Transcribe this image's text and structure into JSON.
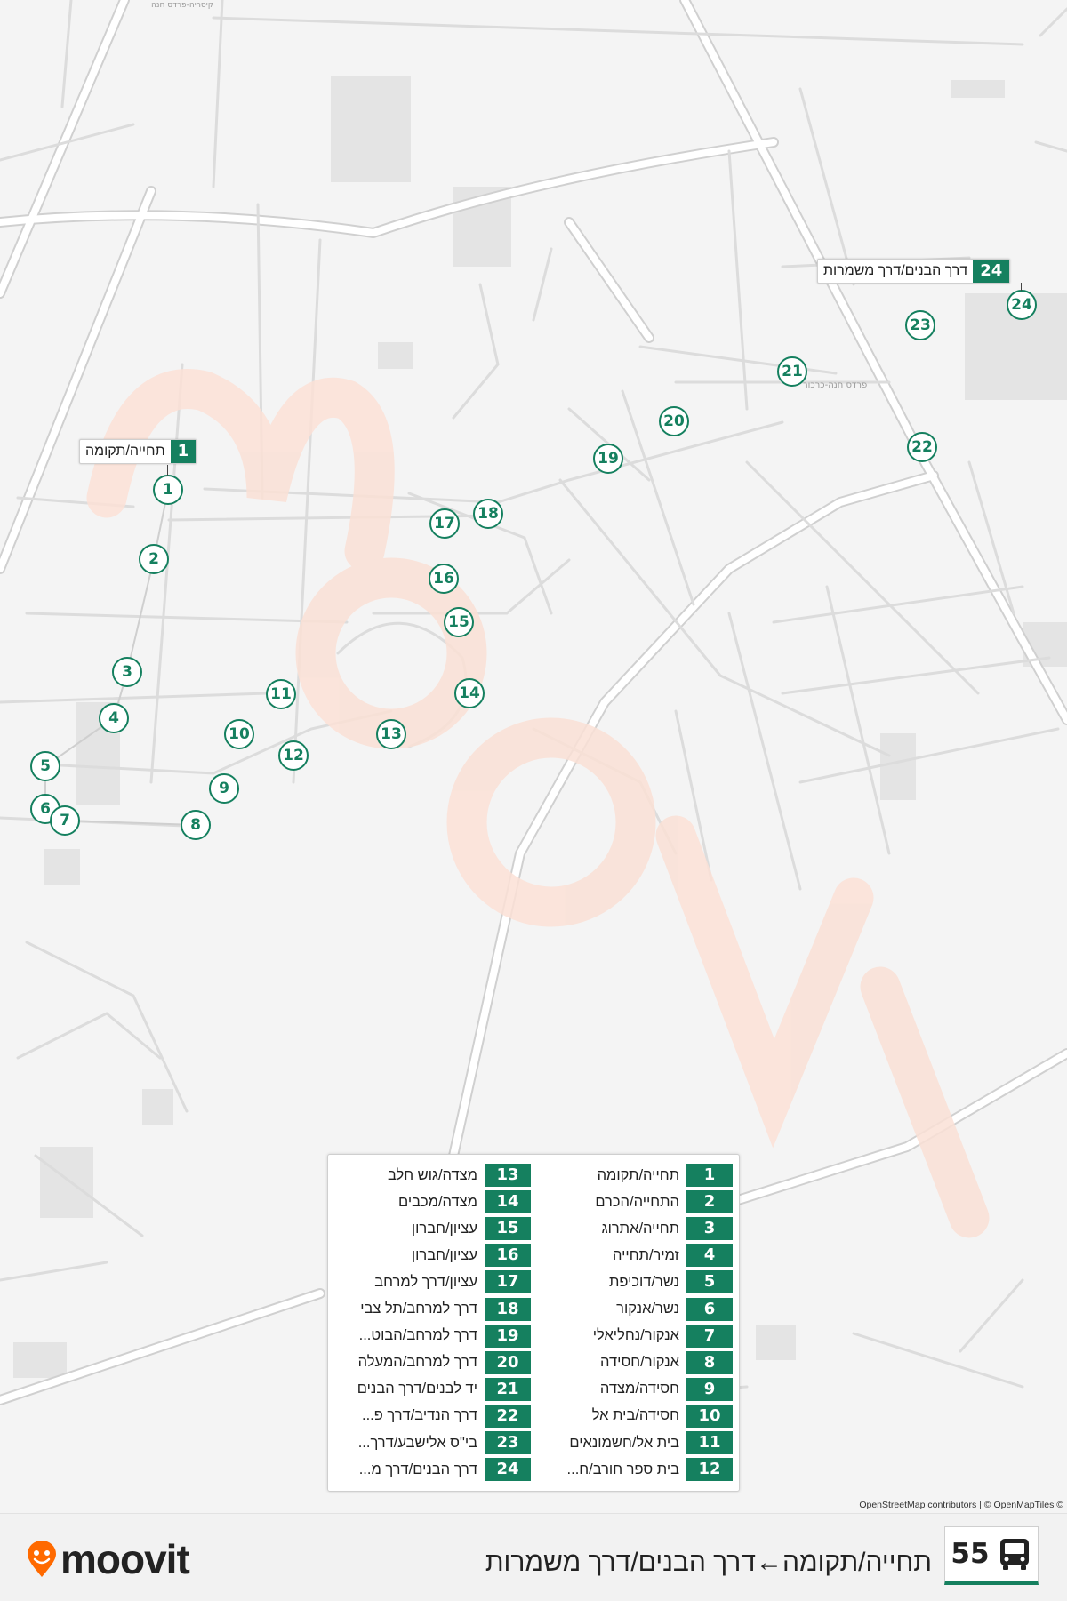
{
  "route": {
    "number": "55",
    "title": "תחייה/תקומה←דרך הבנים/דרך משמרות",
    "bus_icon": "bus-icon",
    "accent_color": "#15805f"
  },
  "brand": {
    "name": "moovit",
    "logo_icon": "moovit-pin-icon",
    "logo_color": "#ff6a00"
  },
  "map": {
    "attribution": "OpenStreetMap contributors | © OpenMapTiles ©",
    "origin_callout": {
      "number": "1",
      "name": "תחייה/תקומה"
    },
    "destination_callout": {
      "number": "24",
      "name": "דרך הבנים/דרך משמרות"
    },
    "street_label_1": "פרדס חנה-כרכור",
    "street_label_2": "קיסריה-פרדס חנה"
  },
  "stops": [
    {
      "number": "1",
      "name": "תחייה/תקומה"
    },
    {
      "number": "2",
      "name": "התחייה/הכרם"
    },
    {
      "number": "3",
      "name": "תחייה/אתרוג"
    },
    {
      "number": "4",
      "name": "זמיר/תחייה"
    },
    {
      "number": "5",
      "name": "נשר/דוכיפת"
    },
    {
      "number": "6",
      "name": "נשר/אנקור"
    },
    {
      "number": "7",
      "name": "אנקור/נחליאלי"
    },
    {
      "number": "8",
      "name": "אנקור/חסידה"
    },
    {
      "number": "9",
      "name": "חסידה/מצדה"
    },
    {
      "number": "10",
      "name": "חסידה/בית אל"
    },
    {
      "number": "11",
      "name": "בית אל/חשמונאים"
    },
    {
      "number": "12",
      "name": "בית ספר חורב/ח..."
    },
    {
      "number": "13",
      "name": "מצדה/גוש חלב"
    },
    {
      "number": "14",
      "name": "מצדה/מכבים"
    },
    {
      "number": "15",
      "name": "עציון/חברון"
    },
    {
      "number": "16",
      "name": "עציון/חברון"
    },
    {
      "number": "17",
      "name": "עציון/דרך למרחב"
    },
    {
      "number": "18",
      "name": "דרך למרחב/תל צבי"
    },
    {
      "number": "19",
      "name": "דרך למרחב/הבוט..."
    },
    {
      "number": "20",
      "name": "דרך למרחב/המעלה"
    },
    {
      "number": "21",
      "name": "יד לבנים/דרך הבנים"
    },
    {
      "number": "22",
      "name": "דרך הנדיב/דרך פ..."
    },
    {
      "number": "23",
      "name": "בי\"ס אלישבע/דרך..."
    },
    {
      "number": "24",
      "name": "דרך הבנים/דרך מ..."
    }
  ]
}
